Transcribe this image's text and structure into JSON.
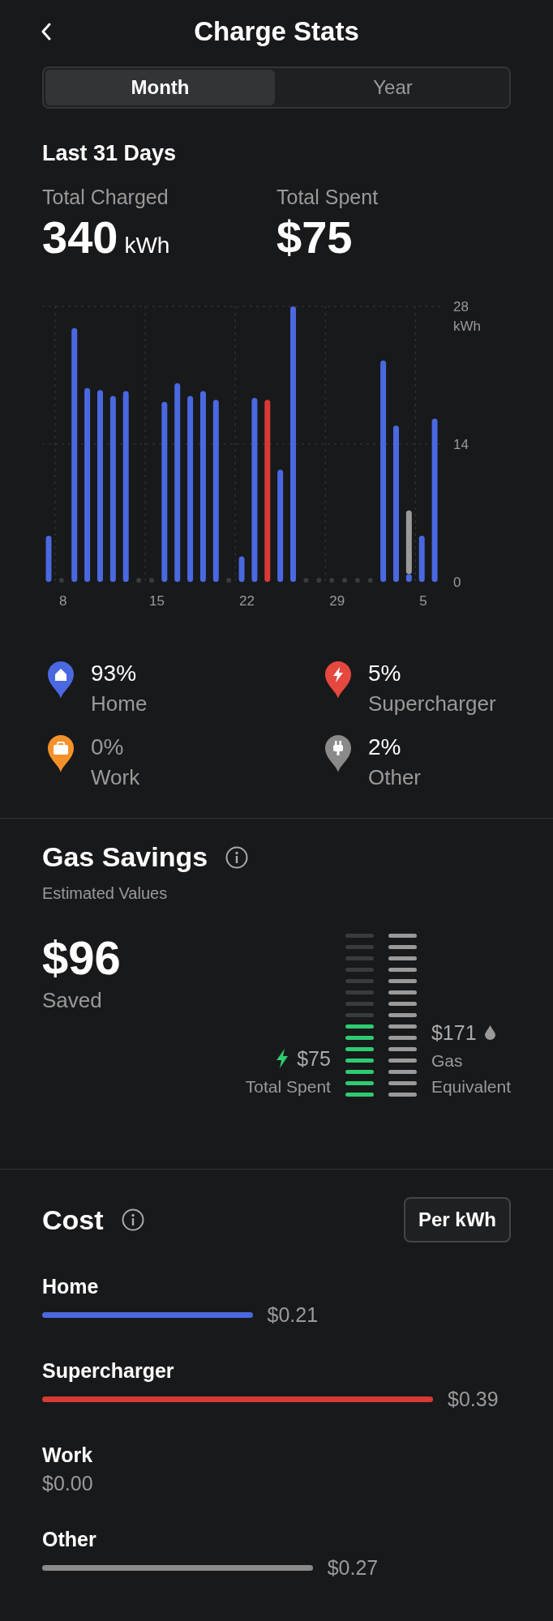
{
  "header": {
    "title": "Charge Stats"
  },
  "tabs": [
    {
      "label": "Month",
      "selected": true
    },
    {
      "label": "Year",
      "selected": false
    }
  ],
  "period": "Last 31 Days",
  "totals": [
    {
      "label": "Total Charged",
      "value": "340",
      "unit": "kWh"
    },
    {
      "label": "Total Spent",
      "value": "$75"
    }
  ],
  "chart_data": {
    "type": "bar",
    "stacked": true,
    "ylabel": "kWh",
    "ylim": [
      0,
      28
    ],
    "yticks": [
      0,
      14,
      28
    ],
    "categories": [
      null,
      "8",
      null,
      null,
      null,
      null,
      null,
      null,
      "15",
      null,
      null,
      null,
      null,
      null,
      null,
      "22",
      null,
      null,
      null,
      null,
      null,
      null,
      "29",
      null,
      null,
      null,
      null,
      null,
      null,
      "5",
      null
    ],
    "series": [
      {
        "color": "#4a68e0",
        "values": [
          4.7,
          null,
          25.8,
          19.7,
          19.5,
          18.9,
          19.4,
          null,
          null,
          18.3,
          20.2,
          18.9,
          19.4,
          18.5,
          null,
          2.6,
          18.7,
          null,
          11.4,
          28,
          null,
          null,
          null,
          null,
          null,
          null,
          22.5,
          15.9,
          0.8,
          4.7,
          16.6
        ]
      },
      {
        "color": "#d63a33",
        "values": [
          null,
          null,
          null,
          null,
          null,
          null,
          null,
          null,
          null,
          null,
          null,
          null,
          null,
          null,
          null,
          null,
          null,
          18.5,
          null,
          null,
          null,
          null,
          null,
          null,
          null,
          null,
          null,
          null,
          null,
          null,
          null
        ]
      },
      {
        "color": "#9a9a9a",
        "values": [
          null,
          null,
          null,
          null,
          null,
          null,
          null,
          null,
          null,
          null,
          null,
          null,
          null,
          null,
          null,
          null,
          null,
          null,
          null,
          null,
          null,
          null,
          null,
          null,
          null,
          null,
          null,
          null,
          6.6,
          null,
          null
        ]
      }
    ]
  },
  "sources": [
    {
      "kind": "home",
      "percent": "93%",
      "label": "Home",
      "color": "#4a68e0",
      "muted": false
    },
    {
      "kind": "supercharger",
      "percent": "5%",
      "label": "Supercharger",
      "color": "#e5483f",
      "muted": false
    },
    {
      "kind": "work",
      "percent": "0%",
      "label": "Work",
      "color": "#f5912a",
      "muted": true
    },
    {
      "kind": "other",
      "percent": "2%",
      "label": "Other",
      "color": "#8a8a8a",
      "muted": false
    }
  ],
  "gas_savings": {
    "title": "Gas Savings",
    "subtitle": "Estimated Values",
    "saved_value": "$96",
    "saved_label": "Saved",
    "spent_value": "$75",
    "spent_label": "Total Spent",
    "spent_meter": {
      "level": 0.47
    },
    "gas_value": "$171",
    "gas_label_1": "Gas",
    "gas_label_2": "Equivalent"
  },
  "cost": {
    "title": "Cost",
    "unit_button": "Per kWh",
    "rows": [
      {
        "label": "Home",
        "value": "$0.21",
        "color": "#4a68e0"
      },
      {
        "label": "Supercharger",
        "value": "$0.39",
        "color": "#d63a33"
      },
      {
        "label": "Work",
        "value": "$0.00"
      },
      {
        "label": "Other",
        "value": "$0.27",
        "color": "#8a8a8a"
      }
    ]
  }
}
